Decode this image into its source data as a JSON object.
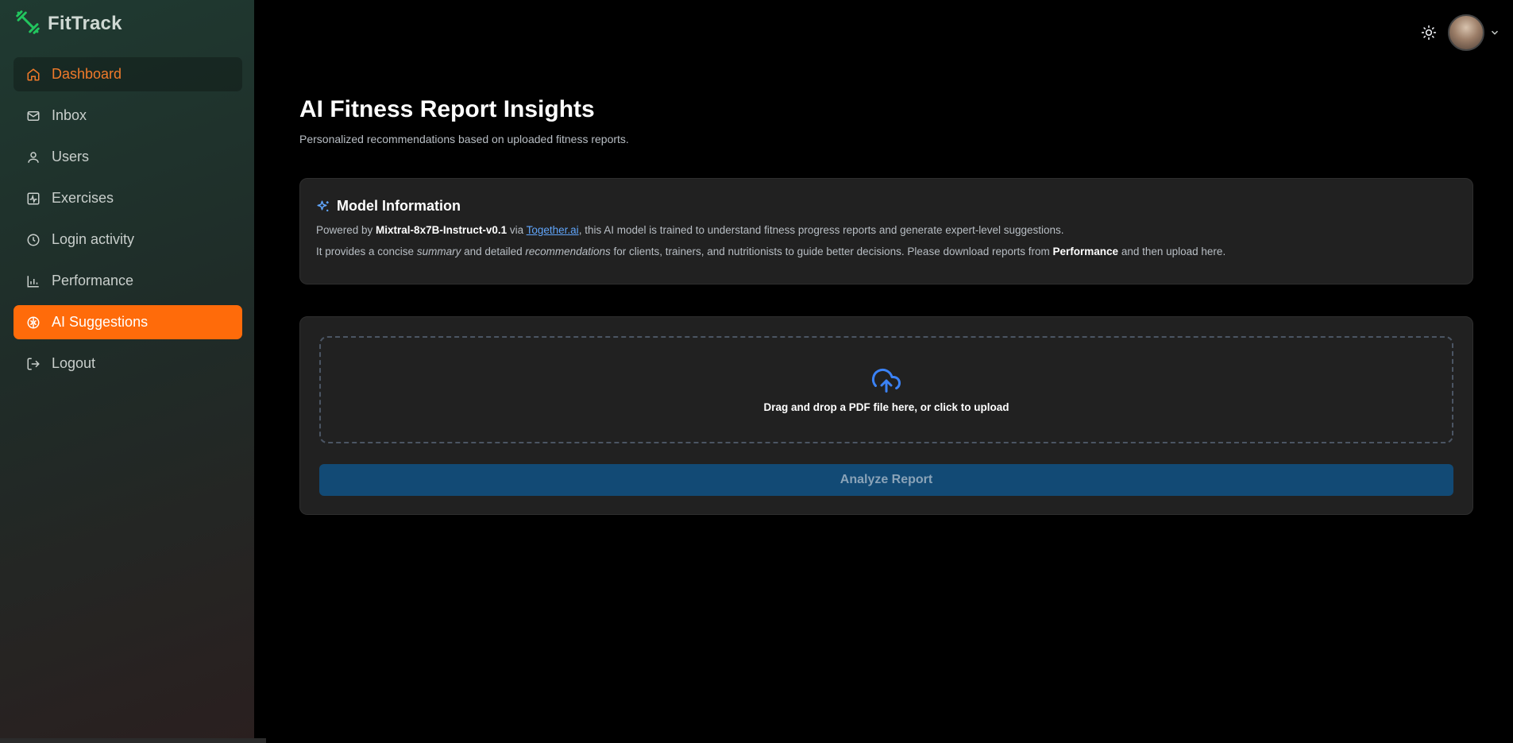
{
  "app": {
    "name": "FitTrack"
  },
  "sidebar": {
    "items": [
      {
        "label": "Dashboard"
      },
      {
        "label": "Inbox"
      },
      {
        "label": "Users"
      },
      {
        "label": "Exercises"
      },
      {
        "label": "Login activity"
      },
      {
        "label": "Performance"
      },
      {
        "label": "AI Suggestions"
      },
      {
        "label": "Logout"
      }
    ]
  },
  "page": {
    "title": "AI Fitness Report Insights",
    "subtitle": "Personalized recommendations based on uploaded fitness reports."
  },
  "model_info": {
    "heading": "Model Information",
    "line1": {
      "prefix": "Powered by ",
      "model": "Mixtral-8x7B-Instruct-v0.1",
      "via": " via ",
      "link": "Together.ai",
      "suffix": ", this AI model is trained to understand fitness progress reports and generate expert-level suggestions."
    },
    "line2": {
      "p1": "It provides a concise ",
      "em1": "summary",
      "p2": " and detailed ",
      "em2": "recommendations",
      "p3": " for clients, trainers, and nutritionists to guide better decisions. Please download reports from ",
      "strong": "Performance",
      "p4": " and then upload here."
    }
  },
  "upload": {
    "dropzone_text": "Drag and drop a PDF file here, or click to upload",
    "analyze_label": "Analyze Report"
  },
  "colors": {
    "accent": "#ff6b0a",
    "primary_button": "#124a75",
    "link": "#60a5fa"
  },
  "icons": [
    "dumbbell-icon",
    "home-icon",
    "mail-icon",
    "user-icon",
    "activity-icon",
    "clock-icon",
    "bar-chart-icon",
    "brain-icon",
    "logout-icon",
    "sun-icon",
    "chevron-down-icon",
    "sparkles-icon",
    "upload-cloud-icon"
  ]
}
